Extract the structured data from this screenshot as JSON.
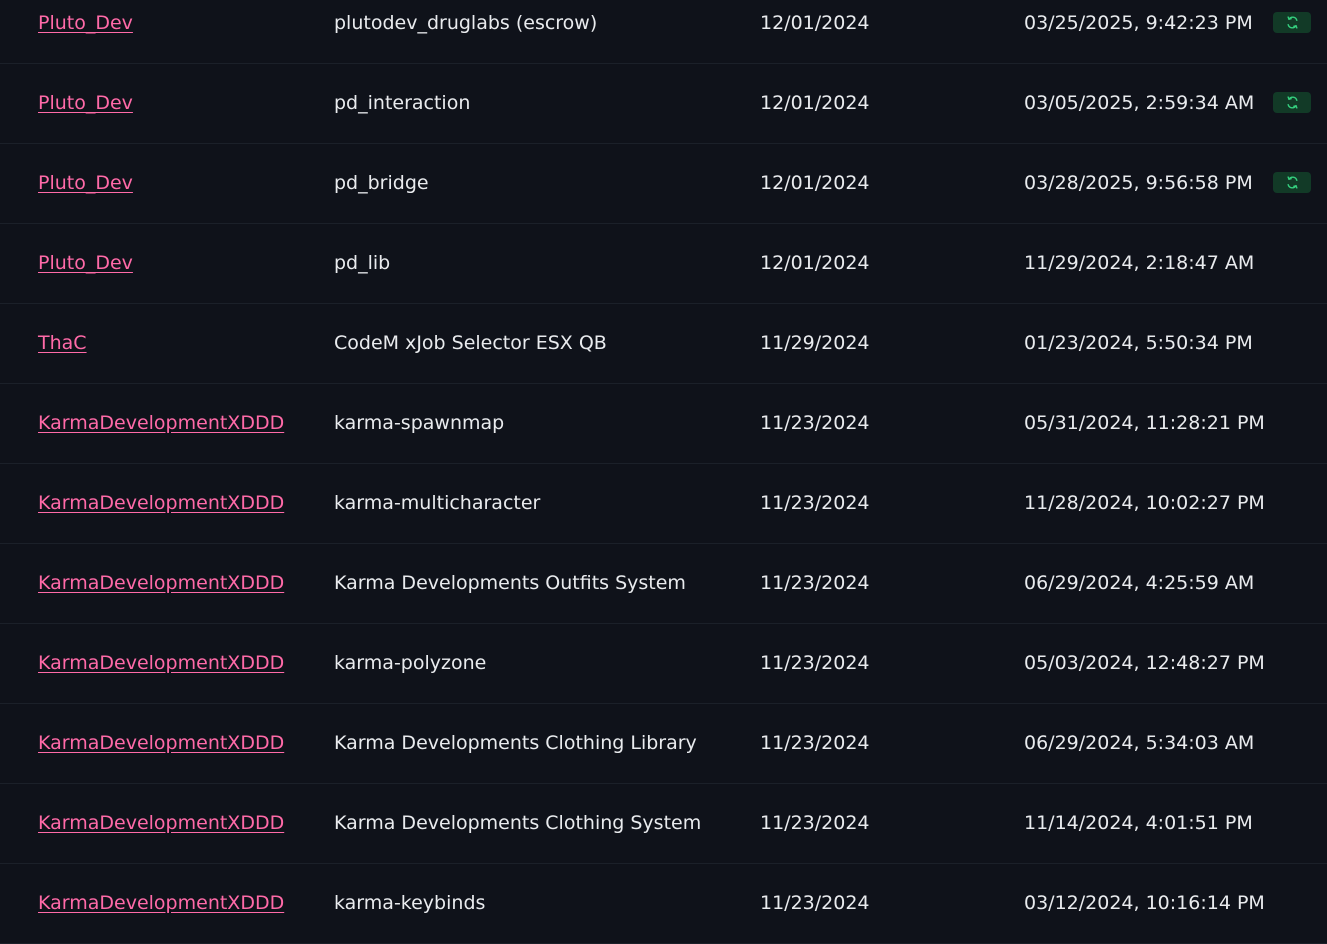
{
  "colors": {
    "background": "#0f121a",
    "row_divider": "#1b2029",
    "text": "#e9ebee",
    "link": "#ff6aa8",
    "badge_bg": "#123a27",
    "badge_icon": "#35d07f"
  },
  "icons": {
    "update_badge": "refresh-icon"
  },
  "rows": [
    {
      "seller": "Pluto_Dev",
      "name": "plutodev_druglabs (escrow)",
      "date": "12/01/2024",
      "updated": "03/25/2025, 9:42:23 PM",
      "update_available": true
    },
    {
      "seller": "Pluto_Dev",
      "name": "pd_interaction",
      "date": "12/01/2024",
      "updated": "03/05/2025, 2:59:34 AM",
      "update_available": true
    },
    {
      "seller": "Pluto_Dev",
      "name": "pd_bridge",
      "date": "12/01/2024",
      "updated": "03/28/2025, 9:56:58 PM",
      "update_available": true
    },
    {
      "seller": "Pluto_Dev",
      "name": "pd_lib",
      "date": "12/01/2024",
      "updated": "11/29/2024, 2:18:47 AM",
      "update_available": false
    },
    {
      "seller": "ThaC",
      "name": "CodeM xJob Selector ESX QB",
      "date": "11/29/2024",
      "updated": "01/23/2024, 5:50:34 PM",
      "update_available": false
    },
    {
      "seller": "KarmaDevelopmentXDDD",
      "name": "karma-spawnmap",
      "date": "11/23/2024",
      "updated": "05/31/2024, 11:28:21 PM",
      "update_available": false
    },
    {
      "seller": "KarmaDevelopmentXDDD",
      "name": "karma-multicharacter",
      "date": "11/23/2024",
      "updated": "11/28/2024, 10:02:27 PM",
      "update_available": false
    },
    {
      "seller": "KarmaDevelopmentXDDD",
      "name": "Karma Developments Outfits System",
      "date": "11/23/2024",
      "updated": "06/29/2024, 4:25:59 AM",
      "update_available": false
    },
    {
      "seller": "KarmaDevelopmentXDDD",
      "name": "karma-polyzone",
      "date": "11/23/2024",
      "updated": "05/03/2024, 12:48:27 PM",
      "update_available": false
    },
    {
      "seller": "KarmaDevelopmentXDDD",
      "name": "Karma Developments Clothing Library",
      "date": "11/23/2024",
      "updated": "06/29/2024, 5:34:03 AM",
      "update_available": false
    },
    {
      "seller": "KarmaDevelopmentXDDD",
      "name": "Karma Developments Clothing System",
      "date": "11/23/2024",
      "updated": "11/14/2024, 4:01:51 PM",
      "update_available": false
    },
    {
      "seller": "KarmaDevelopmentXDDD",
      "name": "karma-keybinds",
      "date": "11/23/2024",
      "updated": "03/12/2024, 10:16:14 PM",
      "update_available": false
    }
  ]
}
